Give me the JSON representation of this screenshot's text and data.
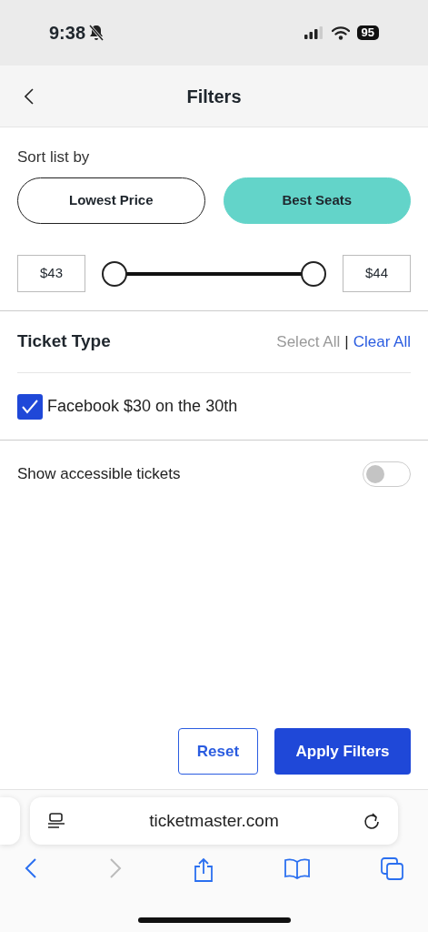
{
  "status_bar": {
    "time": "9:38",
    "battery": "95"
  },
  "header": {
    "title": "Filters"
  },
  "sort": {
    "label": "Sort list by",
    "options": [
      {
        "label": "Lowest Price",
        "selected": false
      },
      {
        "label": "Best Seats",
        "selected": true
      }
    ]
  },
  "price": {
    "min": "$43",
    "max": "$44",
    "thumbs": [
      {
        "level": 0
      },
      {
        "level": 1
      }
    ]
  },
  "ticket_type": {
    "heading": "Ticket Type",
    "select_all": "Select All",
    "separator": "|",
    "clear_all": "Clear All",
    "items": [
      {
        "label": "Facebook $30 on the 30th",
        "checked": true
      }
    ]
  },
  "accessible": {
    "label": "Show accessible tickets",
    "on": false
  },
  "actions": {
    "reset": "Reset",
    "apply": "Apply Filters"
  },
  "browser": {
    "url": "ticketmaster.com",
    "back_disabled": false,
    "forward_disabled": true
  }
}
